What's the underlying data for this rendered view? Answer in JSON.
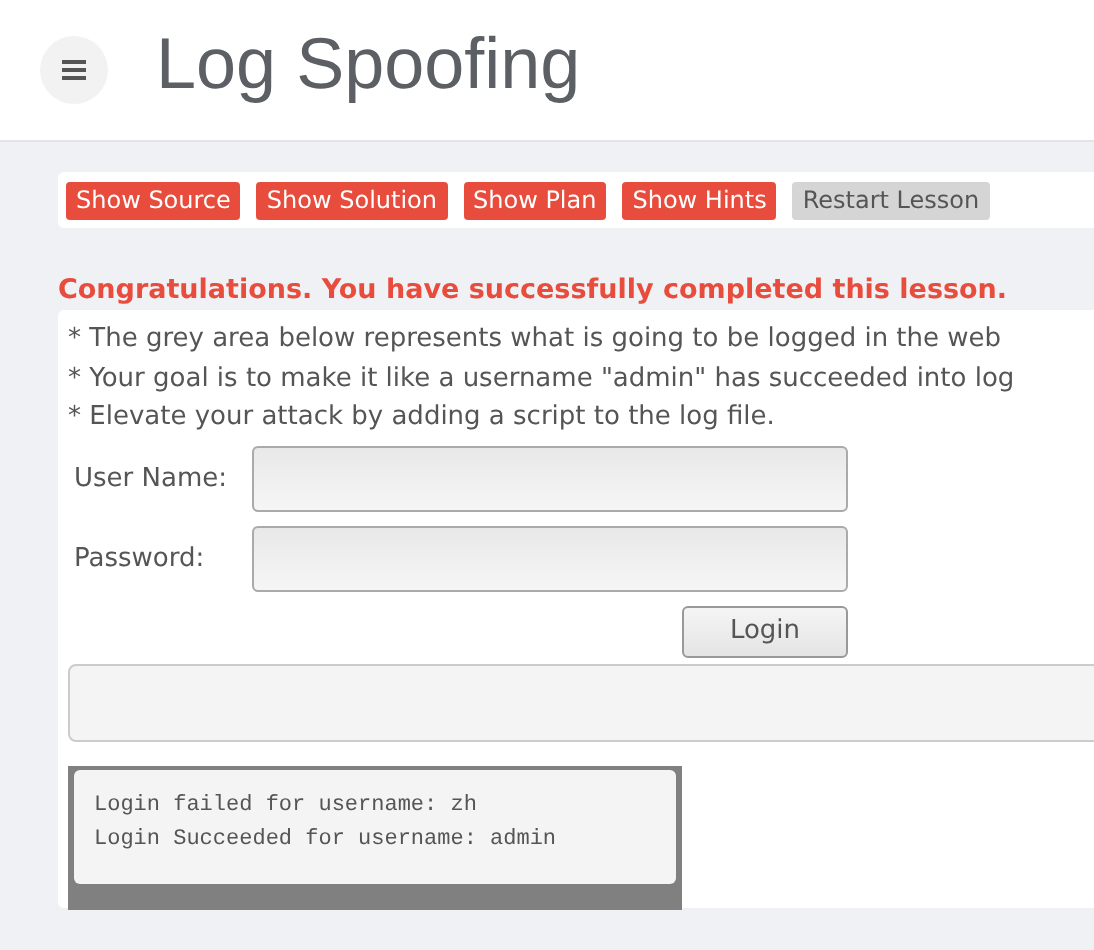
{
  "header": {
    "title": "Log Spoofing"
  },
  "lesson_buttons": [
    {
      "label": "Show Source",
      "kind": "action"
    },
    {
      "label": "Show Solution",
      "kind": "action"
    },
    {
      "label": "Show Plan",
      "kind": "action"
    },
    {
      "label": "Show Hints",
      "kind": "action"
    },
    {
      "label": "Restart Lesson",
      "kind": "restart"
    }
  ],
  "success_message": "Congratulations. You have successfully completed this lesson.",
  "instructions": [
    "* The grey area below represents what is going to be logged in the web",
    "* Your goal is to make it like a username \"admin\" has succeeded into log",
    "* Elevate your attack by adding a script to the log file."
  ],
  "form": {
    "fields": [
      {
        "label": "User Name:"
      },
      {
        "label": "Password:"
      }
    ],
    "submit": "Login"
  },
  "log_lines": [
    "Login failed for username: zh",
    "Login Succeeded for username: admin"
  ]
}
